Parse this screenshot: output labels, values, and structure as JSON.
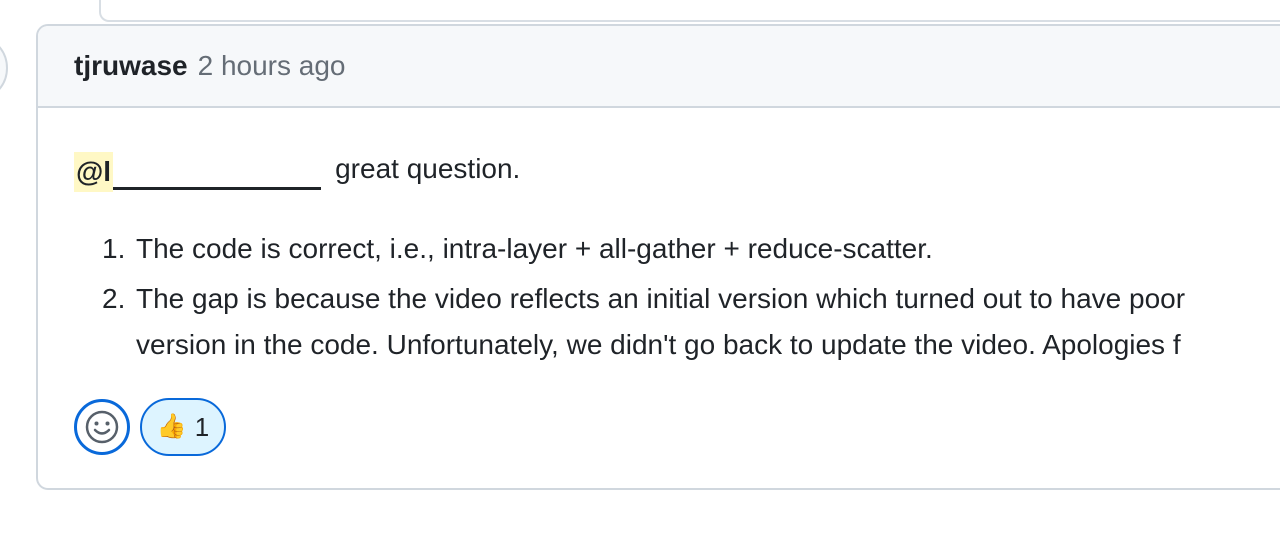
{
  "comment": {
    "author": "tjruwase",
    "timestamp": "2 hours ago",
    "mention": "@l",
    "mention_rest": "great question.",
    "list": [
      {
        "number": "1.",
        "lines": [
          "The code is correct, i.e., intra-layer + all-gather + reduce-scatter."
        ]
      },
      {
        "number": "2.",
        "lines": [
          "The gap is because the video reflects an initial version which turned out to have poor",
          "version in the code. Unfortunately, we didn't go back to update the video. Apologies f"
        ]
      }
    ],
    "reactions": {
      "add_icon": "smiley-icon",
      "items": [
        {
          "icon": "thumbs-up-icon",
          "emoji": "👍",
          "count": "1"
        }
      ]
    }
  },
  "colors": {
    "accent": "#0969da",
    "header_bg": "#f6f8fa",
    "border": "#d0d7de",
    "mention_bg": "#fff8c5",
    "reaction_bg": "#ddf4ff"
  }
}
